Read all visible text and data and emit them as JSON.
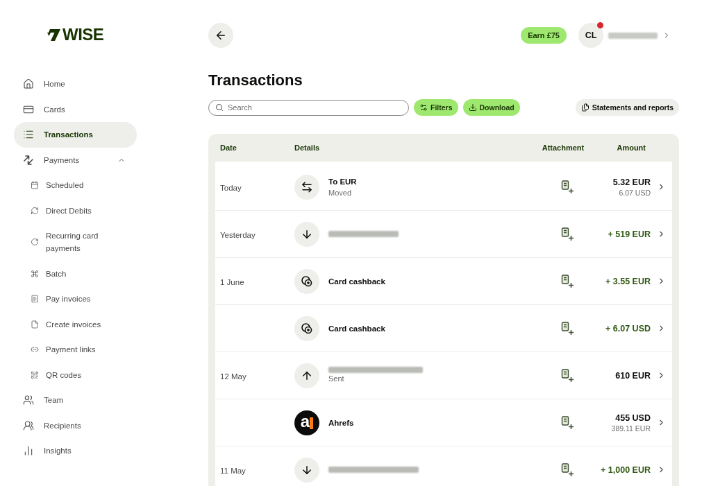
{
  "sidebar": {
    "logo": "WISE",
    "items": [
      {
        "label": "Home",
        "selected": false
      },
      {
        "label": "Cards",
        "selected": false
      },
      {
        "label": "Transactions",
        "selected": true
      },
      {
        "label": "Payments",
        "selected": false,
        "expanded": true,
        "children": [
          {
            "label": "Scheduled",
            "selected": false
          },
          {
            "label": "Direct Debits",
            "selected": false
          },
          {
            "label": "Recurring card payments",
            "selected": false
          },
          {
            "label": "Batch",
            "selected": false
          },
          {
            "label": "Pay invoices",
            "selected": false
          },
          {
            "label": "Create invoices",
            "selected": false
          },
          {
            "label": "Payment links",
            "selected": false
          },
          {
            "label": "QR codes",
            "selected": false
          }
        ]
      },
      {
        "label": "Team",
        "selected": false
      },
      {
        "label": "Recipients",
        "selected": false
      },
      {
        "label": "Insights",
        "selected": false
      }
    ]
  },
  "header": {
    "earn_button": "Earn £75",
    "account": {
      "initials": "CL",
      "notification": true
    }
  },
  "title": "Transactions",
  "toolbar": {
    "search": {
      "placeholder": "Search"
    },
    "buttons": [
      {
        "label": "Filters",
        "kind": "primary"
      },
      {
        "label": "Download",
        "kind": "primary"
      },
      {
        "label": "Statements and reports",
        "kind": "secondary"
      }
    ]
  },
  "table": {
    "columns": [
      "Date",
      "Details",
      "Attachment",
      "Amount"
    ],
    "rows": [
      {
        "date": "Today",
        "kind": "moved",
        "redacted": false,
        "title": "To EUR",
        "subtitle": "Moved",
        "amount": "5.32 EUR",
        "amount_secondary": "6.07 USD",
        "credit": false
      },
      {
        "date": "Yesterday",
        "kind": "received",
        "redacted": true,
        "amount": "+ 519 EUR",
        "credit": true
      },
      {
        "date": "1 June",
        "kind": "cashback",
        "redacted": false,
        "title": "Card cashback",
        "amount": "+ 3.55 EUR",
        "credit": true
      },
      {
        "kind": "cashback",
        "redacted": false,
        "title": "Card cashback",
        "amount": "+ 6.07 USD",
        "credit": true
      },
      {
        "date": "12 May",
        "kind": "sent",
        "redacted": true,
        "subtitle": "Sent",
        "amount": "610 EUR",
        "credit": false
      },
      {
        "kind": "merchant",
        "logo": "a",
        "redacted": false,
        "title": "Ahrefs",
        "amount": "455 USD",
        "amount_secondary": "389.11 EUR",
        "credit": false
      },
      {
        "date": "11 May",
        "kind": "received",
        "redacted": true,
        "amount": "+ 1,000 EUR",
        "credit": true
      }
    ]
  }
}
